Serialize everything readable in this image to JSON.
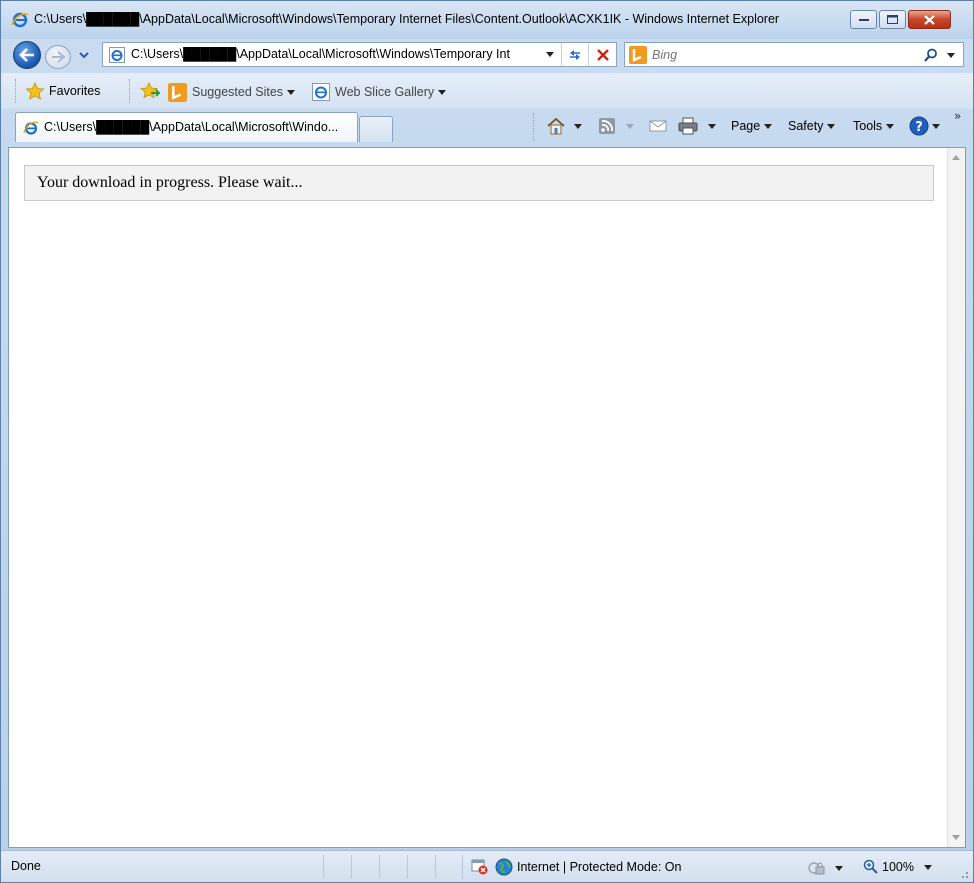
{
  "window": {
    "title": "C:\\Users\\██████\\AppData\\Local\\Microsoft\\Windows\\Temporary Internet Files\\Content.Outlook\\ACXK1IK - Windows Internet Explorer"
  },
  "address_bar": {
    "url": "C:\\Users\\██████\\AppData\\Local\\Microsoft\\Windows\\Temporary Int"
  },
  "search": {
    "placeholder": "Bing"
  },
  "favorites_bar": {
    "favorites_label": "Favorites",
    "suggested_sites_label": "Suggested Sites",
    "web_slice_gallery_label": "Web Slice Gallery"
  },
  "tabs": [
    {
      "label": "C:\\Users\\██████\\AppData\\Local\\Microsoft\\Windo..."
    }
  ],
  "command_bar": {
    "page_label": "Page",
    "safety_label": "Safety",
    "tools_label": "Tools"
  },
  "content": {
    "message": "Your download in progress. Please wait..."
  },
  "status_bar": {
    "status_text": "Done",
    "zone_text": "Internet | Protected Mode: On",
    "zoom_text": "100%"
  },
  "colors": {
    "frame": "#b9cfe8",
    "close_button": "#c7452a",
    "message_background": "#f2f2f2",
    "bing_orange": "#f29a1f"
  },
  "icons": [
    "ie-icon",
    "back-arrow-icon",
    "forward-arrow-icon",
    "refresh-icon",
    "stop-icon",
    "bing-icon",
    "search-icon",
    "favorites-star-icon",
    "add-favorites-icon",
    "web-slice-icon",
    "home-icon",
    "feeds-icon",
    "mail-icon",
    "print-icon",
    "help-icon",
    "popup-blocked-icon",
    "globe-icon",
    "lock-icon",
    "zoom-magnifier-icon"
  ]
}
